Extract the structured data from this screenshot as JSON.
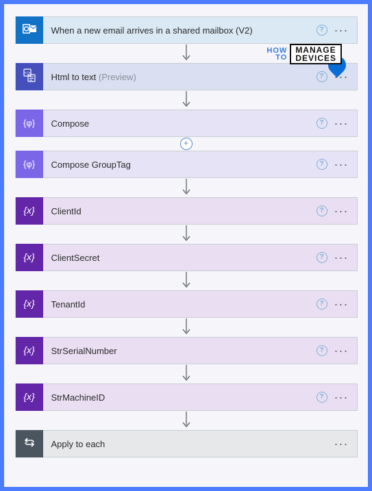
{
  "watermark": {
    "how": "HOW",
    "to": "TO",
    "manage": "MANAGE",
    "devices": "DEVICES"
  },
  "steps": [
    {
      "label": "When a new email arrives in a shared mailbox (V2)",
      "preview": "",
      "theme": "t-outlook",
      "icon": "outlook",
      "help": true
    },
    {
      "label": "Html to text",
      "preview": "(Preview)",
      "theme": "t-html",
      "icon": "code",
      "help": true
    },
    {
      "label": "Compose",
      "preview": "",
      "theme": "t-compose",
      "icon": "braces",
      "help": true,
      "addAfter": true
    },
    {
      "label": "Compose GroupTag",
      "preview": "",
      "theme": "t-compose",
      "icon": "braces",
      "help": true
    },
    {
      "label": "ClientId",
      "preview": "",
      "theme": "t-var",
      "icon": "var",
      "help": true
    },
    {
      "label": "ClientSecret",
      "preview": "",
      "theme": "t-var",
      "icon": "var",
      "help": true
    },
    {
      "label": "TenantId",
      "preview": "",
      "theme": "t-var",
      "icon": "var",
      "help": true
    },
    {
      "label": "StrSerialNumber",
      "preview": "",
      "theme": "t-var",
      "icon": "var",
      "help": true
    },
    {
      "label": "StrMachineID",
      "preview": "",
      "theme": "t-var",
      "icon": "var",
      "help": true
    },
    {
      "label": "Apply to each",
      "preview": "",
      "theme": "t-foreach",
      "icon": "loop",
      "help": false
    }
  ]
}
